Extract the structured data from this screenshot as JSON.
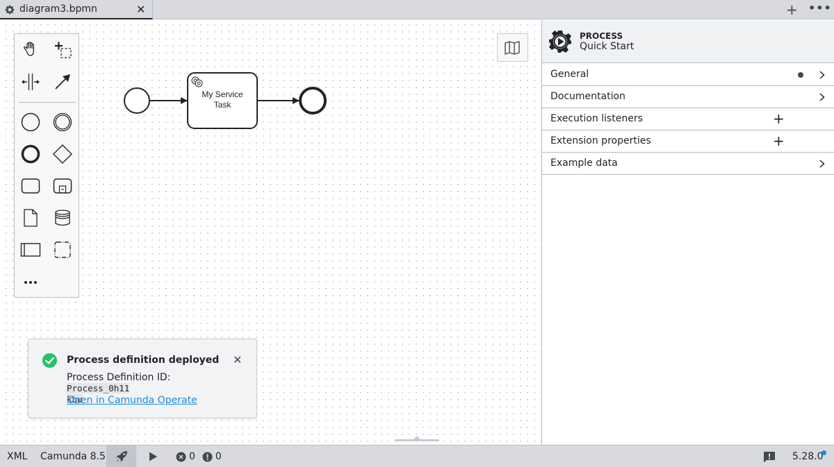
{
  "tabbar": {
    "tabs": [
      {
        "title": "diagram3.bpmn",
        "icon": "gear-icon",
        "active": true
      }
    ],
    "new_tab_icon": "plus-icon",
    "more_icon": "more-horizontal-icon"
  },
  "palette": {
    "tools": [
      {
        "name": "hand-tool",
        "icon": "hand-icon"
      },
      {
        "name": "lasso-tool",
        "icon": "lasso-icon"
      },
      {
        "name": "space-tool",
        "icon": "space-tool-icon"
      },
      {
        "name": "global-connect-tool",
        "icon": "connect-arrow-icon"
      },
      {
        "name": "create-start-event",
        "icon": "start-event-icon"
      },
      {
        "name": "create-intermediate-event",
        "icon": "intermediate-event-icon"
      },
      {
        "name": "create-end-event",
        "icon": "end-event-icon"
      },
      {
        "name": "create-gateway",
        "icon": "gateway-icon"
      },
      {
        "name": "create-task",
        "icon": "task-icon"
      },
      {
        "name": "create-subprocess",
        "icon": "subprocess-icon"
      },
      {
        "name": "create-data-object",
        "icon": "data-object-icon"
      },
      {
        "name": "create-data-store",
        "icon": "data-store-icon"
      },
      {
        "name": "create-pool",
        "icon": "pool-icon"
      },
      {
        "name": "create-group",
        "icon": "group-icon"
      },
      {
        "name": "more-elements",
        "icon": "more-horizontal-icon"
      }
    ]
  },
  "diagram": {
    "elements": [
      {
        "type": "startEvent"
      },
      {
        "type": "serviceTask",
        "label": "My Service Task"
      },
      {
        "type": "endEvent"
      }
    ],
    "task_label_line1": "My Service",
    "task_label_line2": "Task"
  },
  "toast": {
    "title": "Process definition deployed",
    "body_prefix": "Process Definition ID: ",
    "process_id": "Process_0h11kbu",
    "process_id_line1": "Process_0h11",
    "process_id_line2": "kbu",
    "link_label": "Open in Camunda Operate",
    "status": "success",
    "status_color": "#26c267"
  },
  "properties_panel": {
    "element_type": "PROCESS",
    "element_name": "Quick Start",
    "groups": [
      {
        "label": "General",
        "action": "expand",
        "has_dot": true
      },
      {
        "label": "Documentation",
        "action": "expand",
        "has_dot": false
      },
      {
        "label": "Execution listeners",
        "action": "add",
        "has_dot": false
      },
      {
        "label": "Extension properties",
        "action": "add",
        "has_dot": false
      },
      {
        "label": "Example data",
        "action": "expand",
        "has_dot": false
      }
    ]
  },
  "statusbar": {
    "xml_label": "XML",
    "engine_label": "Camunda 8.5",
    "deploy_icon": "rocket-icon",
    "run_icon": "play-icon",
    "errors_count": "0",
    "warnings_count": "0",
    "version": "5.28.0",
    "update_dot_color": "#1a8ce0"
  },
  "colors": {
    "accent": "#1a8ce0",
    "success": "#26c267",
    "chrome": "#d9dadf",
    "text": "#22242a"
  }
}
